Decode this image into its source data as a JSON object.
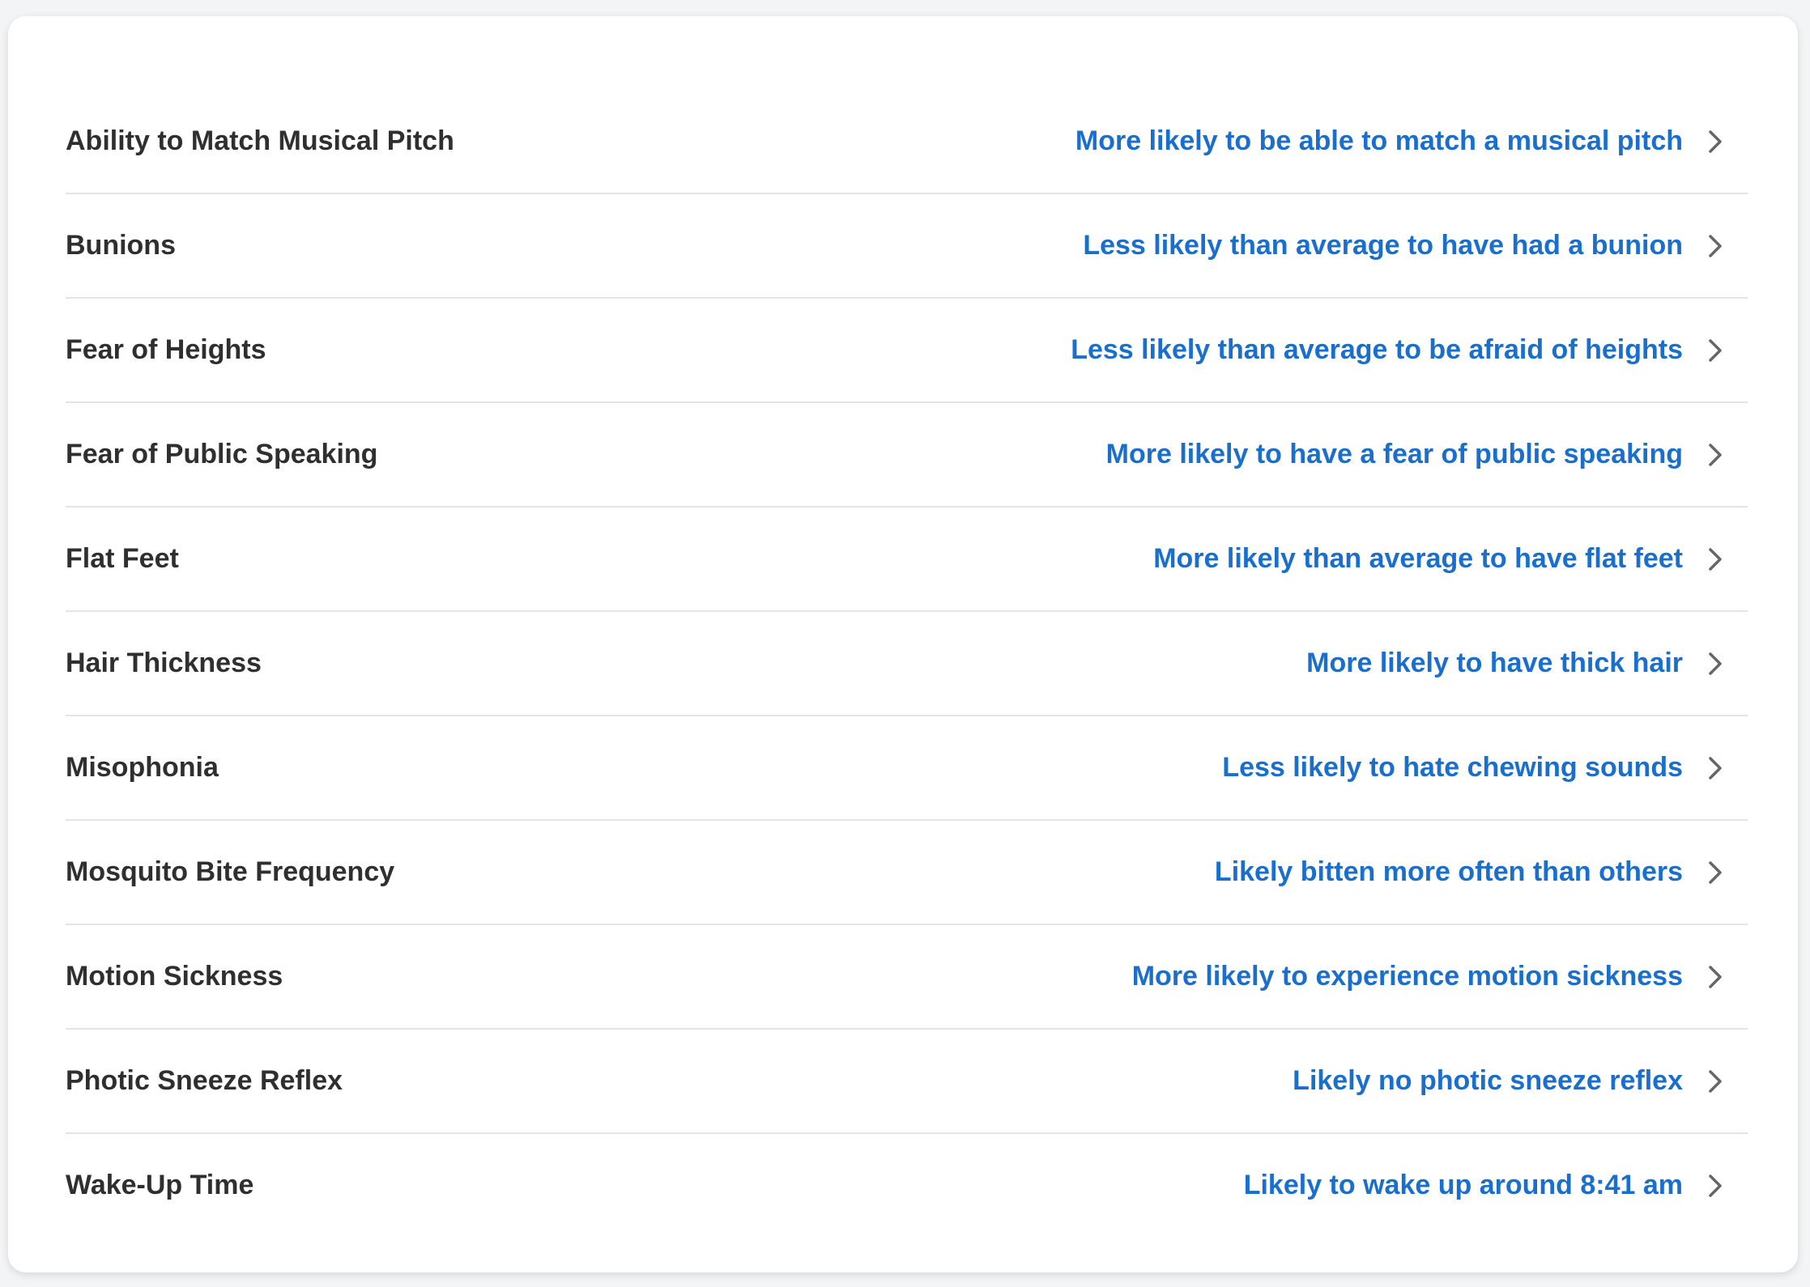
{
  "traits": [
    {
      "title": "Ability to Match Musical Pitch",
      "result": "More likely to be able to match a musical pitch"
    },
    {
      "title": "Bunions",
      "result": "Less likely than average to have had a bunion"
    },
    {
      "title": "Fear of Heights",
      "result": "Less likely than average to be afraid of heights"
    },
    {
      "title": "Fear of Public Speaking",
      "result": "More likely to have a fear of public speaking"
    },
    {
      "title": "Flat Feet",
      "result": "More likely than average to have flat feet"
    },
    {
      "title": "Hair Thickness",
      "result": "More likely to have thick hair"
    },
    {
      "title": "Misophonia",
      "result": "Less likely to hate chewing sounds"
    },
    {
      "title": "Mosquito Bite Frequency",
      "result": "Likely bitten more often than others"
    },
    {
      "title": "Motion Sickness",
      "result": "More likely to experience motion sickness"
    },
    {
      "title": "Photic Sneeze Reflex",
      "result": "Likely no photic sneeze reflex"
    },
    {
      "title": "Wake-Up Time",
      "result": "Likely to wake up around 8:41 am"
    }
  ],
  "colors": {
    "accent": "#1a6fcc",
    "title": "#2f2f2f",
    "chevron": "#666666"
  },
  "icons": {
    "row_action": "chevron-right-icon"
  }
}
